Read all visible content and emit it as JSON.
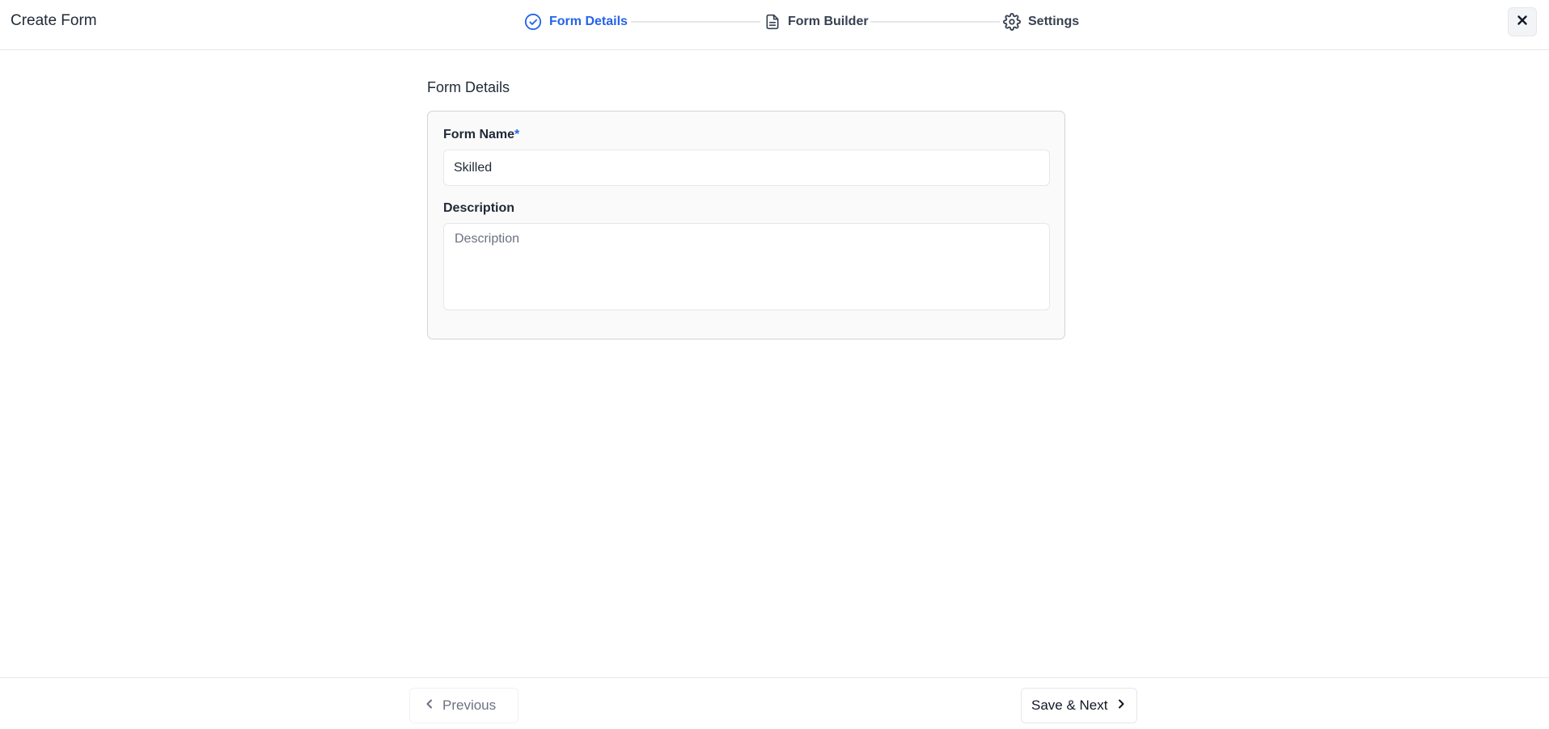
{
  "header": {
    "title": "Create Form",
    "close_icon": "close-icon"
  },
  "stepper": {
    "steps": [
      {
        "label": "Form Details",
        "icon": "check-circle-icon",
        "state": "active"
      },
      {
        "label": "Form Builder",
        "icon": "document-icon",
        "state": "pending"
      },
      {
        "label": "Settings",
        "icon": "gear-icon",
        "state": "pending"
      }
    ]
  },
  "main": {
    "section_title": "Form Details",
    "form_name": {
      "label": "Form Name",
      "required_marker": "*",
      "value": "Skilled"
    },
    "description": {
      "label": "Description",
      "placeholder": "Description",
      "value": ""
    }
  },
  "footer": {
    "previous_label": "Previous",
    "next_label": "Save & Next"
  },
  "colors": {
    "accent": "#2563eb",
    "text": "#1f2937",
    "border": "#e5e7eb",
    "card_bg": "#fafafa"
  }
}
